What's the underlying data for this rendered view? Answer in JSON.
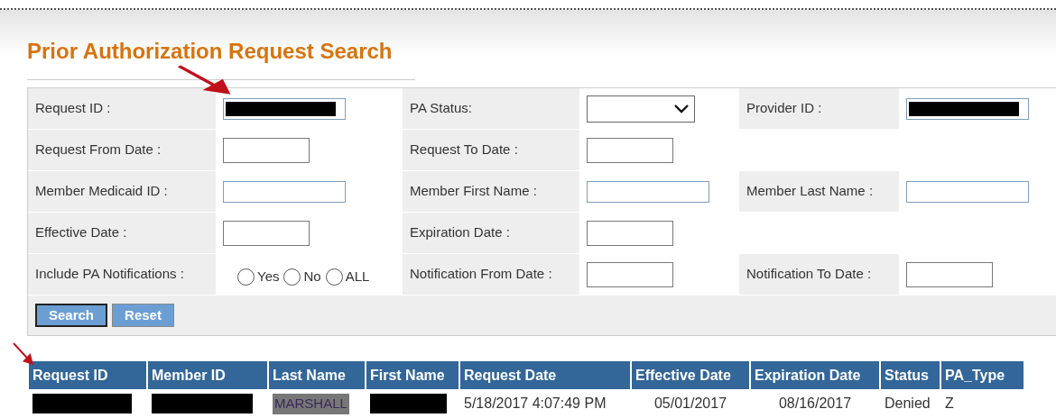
{
  "title": "Prior Authorization Request Search",
  "form_rows": [
    {
      "cells": [
        {
          "label": "Request ID :",
          "field": {
            "kind": "text",
            "redacted": true
          }
        },
        {
          "label": "PA Status:",
          "field": {
            "kind": "select"
          }
        },
        {
          "label": "Provider ID :",
          "field": {
            "kind": "text",
            "redacted": true
          }
        }
      ]
    },
    {
      "cells": [
        {
          "label": "Request From Date :",
          "field": {
            "kind": "date",
            "redacted": false
          }
        },
        {
          "label": "Request To Date :",
          "field": {
            "kind": "date",
            "redacted": false
          }
        },
        {
          "kind": "empty"
        }
      ]
    },
    {
      "cells": [
        {
          "label": "Member Medicaid ID :",
          "field": {
            "kind": "text",
            "redacted": false
          }
        },
        {
          "label": "Member First Name :",
          "field": {
            "kind": "text",
            "redacted": false
          }
        },
        {
          "label": "Member Last Name :",
          "field": {
            "kind": "text",
            "redacted": false
          }
        }
      ]
    },
    {
      "cells": [
        {
          "label": "Effective Date :",
          "field": {
            "kind": "date",
            "redacted": false
          }
        },
        {
          "label": "Expiration Date :",
          "field": {
            "kind": "date",
            "redacted": false
          }
        },
        {
          "kind": "empty"
        }
      ]
    },
    {
      "cells": [
        {
          "label": "Include PA Notifications :",
          "field": {
            "kind": "radio",
            "options": [
              {
                "label": "Yes",
                "selected": false
              },
              {
                "label": "No",
                "selected": false
              },
              {
                "label": "ALL",
                "selected": false
              }
            ]
          }
        },
        {
          "label": "Notification From Date :",
          "field": {
            "kind": "date",
            "redacted": false
          }
        },
        {
          "label": "Notification To Date :",
          "field": {
            "kind": "date",
            "redacted": false
          }
        }
      ]
    }
  ],
  "buttons": [
    {
      "label": "Search",
      "focused": true
    },
    {
      "label": "Reset",
      "focused": false
    }
  ],
  "table": {
    "columns": [
      "Request ID",
      "Member ID",
      "Last Name",
      "First Name",
      "Request Date",
      "Effective Date",
      "Expiration Date",
      "Status",
      "PA_Type"
    ],
    "rows": [
      {
        "cells": [
          {
            "redacted": true
          },
          {
            "redacted": true
          },
          {
            "text": "MARSHALL",
            "redacted": false,
            "obscured": true
          },
          {
            "redacted": true
          },
          {
            "text": "5/18/2017 4:07:49 PM",
            "redacted": false
          },
          {
            "text": "05/01/2017",
            "redacted": false
          },
          {
            "text": "08/16/2017",
            "redacted": false
          },
          {
            "text": "Denied",
            "redacted": false
          },
          {
            "text": "Z",
            "redacted": false
          }
        ]
      }
    ]
  },
  "annotation_arrows": [
    {
      "kind": "arrow"
    },
    {
      "kind": "arrow"
    }
  ]
}
